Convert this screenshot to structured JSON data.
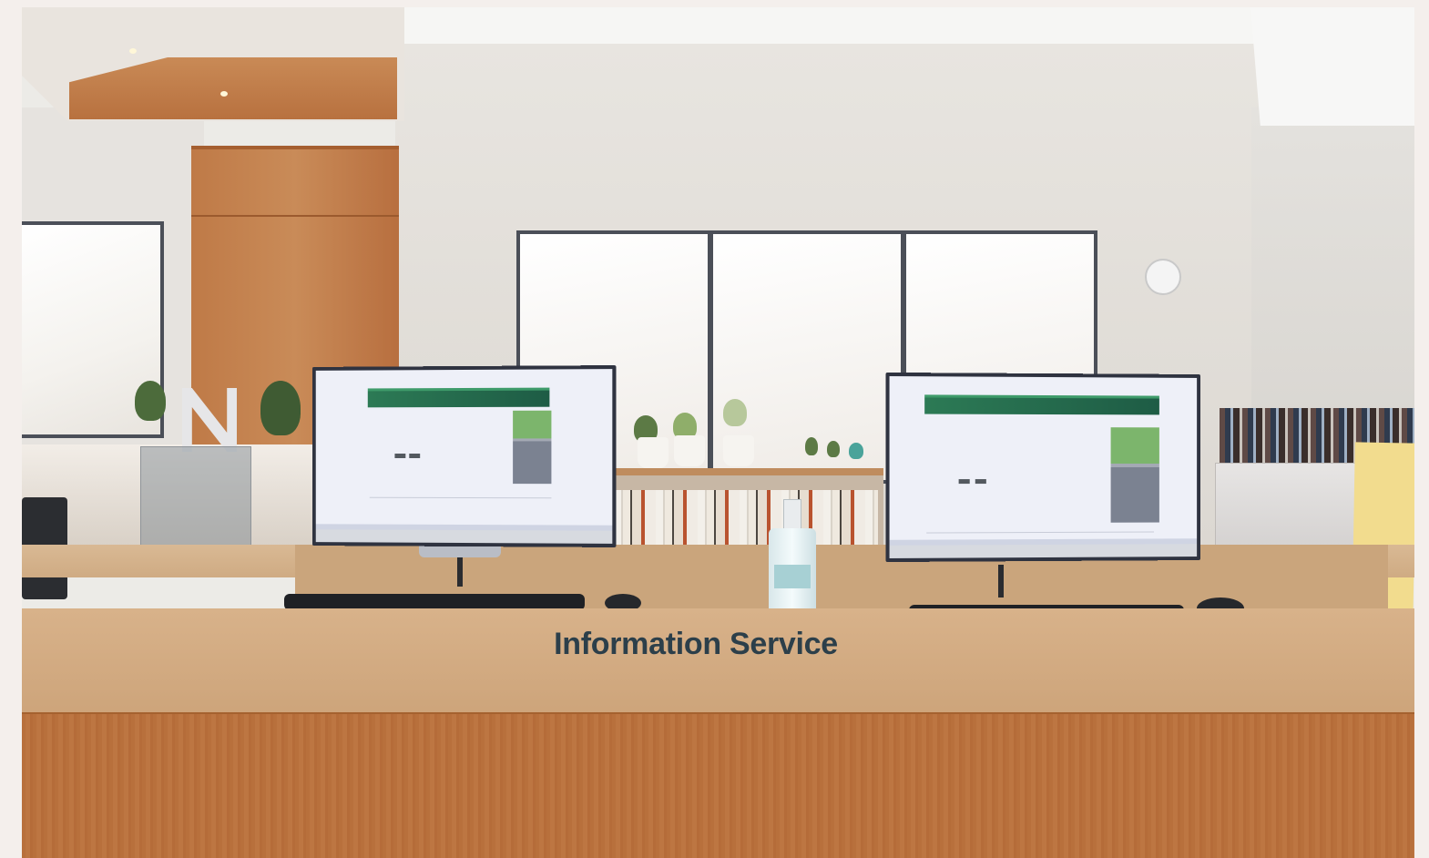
{
  "scene": {
    "sign_title": "Information Service"
  },
  "colors": {
    "wood": "#c98b58",
    "counter": "#d8b28a",
    "screen_header_green": "#2c7a55",
    "sign_text": "#2c3f4a"
  },
  "icons": {
    "sanitizer": "sanitizer-bottle-icon",
    "detector": "smoke-detector-icon"
  }
}
